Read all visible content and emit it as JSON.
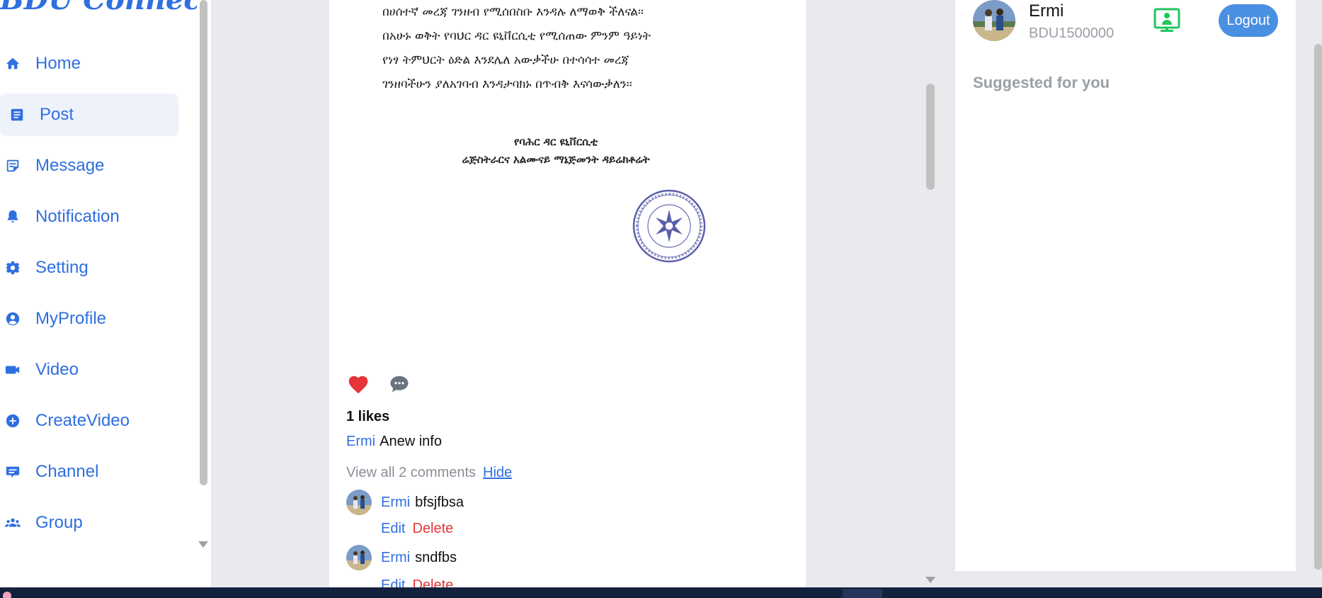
{
  "app": {
    "brand": "BDU Connect"
  },
  "sidebar": {
    "items": [
      {
        "label": "Home",
        "icon": "home-icon",
        "active": false
      },
      {
        "label": "Post",
        "icon": "post-icon",
        "active": true
      },
      {
        "label": "Message",
        "icon": "message-icon",
        "active": false
      },
      {
        "label": "Notification",
        "icon": "bell-icon",
        "active": false
      },
      {
        "label": "Setting",
        "icon": "gear-icon",
        "active": false
      },
      {
        "label": "MyProfile",
        "icon": "user-circle-icon",
        "active": false
      },
      {
        "label": "Video",
        "icon": "video-camera-icon",
        "active": false
      },
      {
        "label": "CreateVideo",
        "icon": "plus-circle-icon",
        "active": false
      },
      {
        "label": "Channel",
        "icon": "channel-icon",
        "active": false
      },
      {
        "label": "Group",
        "icon": "group-icon",
        "active": false
      }
    ]
  },
  "post": {
    "document_lines": [
      "በሀሰተኛ መረጃ ገንዘብ የሚሰበስቡ እንዳሉ ለማወቅ ችለናል፡፡",
      "በአሁኑ ወቅት የባህር ዳር ዩኒቨርሲቲ የሚሰጠው ምንም ዓይነት",
      "የነፃ ትምህርት ዕድል እንደሌለ አውቃችሁ በተሳሳተ መረጃ",
      "ገንዘባችሁን ያለአገባብ እንዳታባክኑ በጥብቅ እናሳውቃለን፡፡"
    ],
    "document_signature": [
      "የባሕር ዳር ዩኒቨርሲቲ",
      "ሬጅስትራርና አልሙናይ ማኔጅመንት ዳይሬክቶሬት"
    ],
    "likes_text": "1 likes",
    "caption_author": "Ermi",
    "caption_text": "Anew info",
    "view_comments_text": "View all 2 comments",
    "hide_label": "Hide",
    "comments": [
      {
        "author": "Ermi",
        "text": "bfsjfbsa",
        "edit_label": "Edit",
        "delete_label": "Delete"
      },
      {
        "author": "Ermi",
        "text": "sndfbs",
        "edit_label": "Edit",
        "delete_label": "Delete"
      }
    ],
    "liked": true
  },
  "profile": {
    "name": "Ermi",
    "user_id": "BDU1500000",
    "logout_label": "Logout",
    "suggested_heading": "Suggested for you"
  },
  "colors": {
    "accent": "#2f6fe0",
    "like": "#e5343a",
    "logout": "#4a90e2",
    "video_call": "#22c55e"
  }
}
